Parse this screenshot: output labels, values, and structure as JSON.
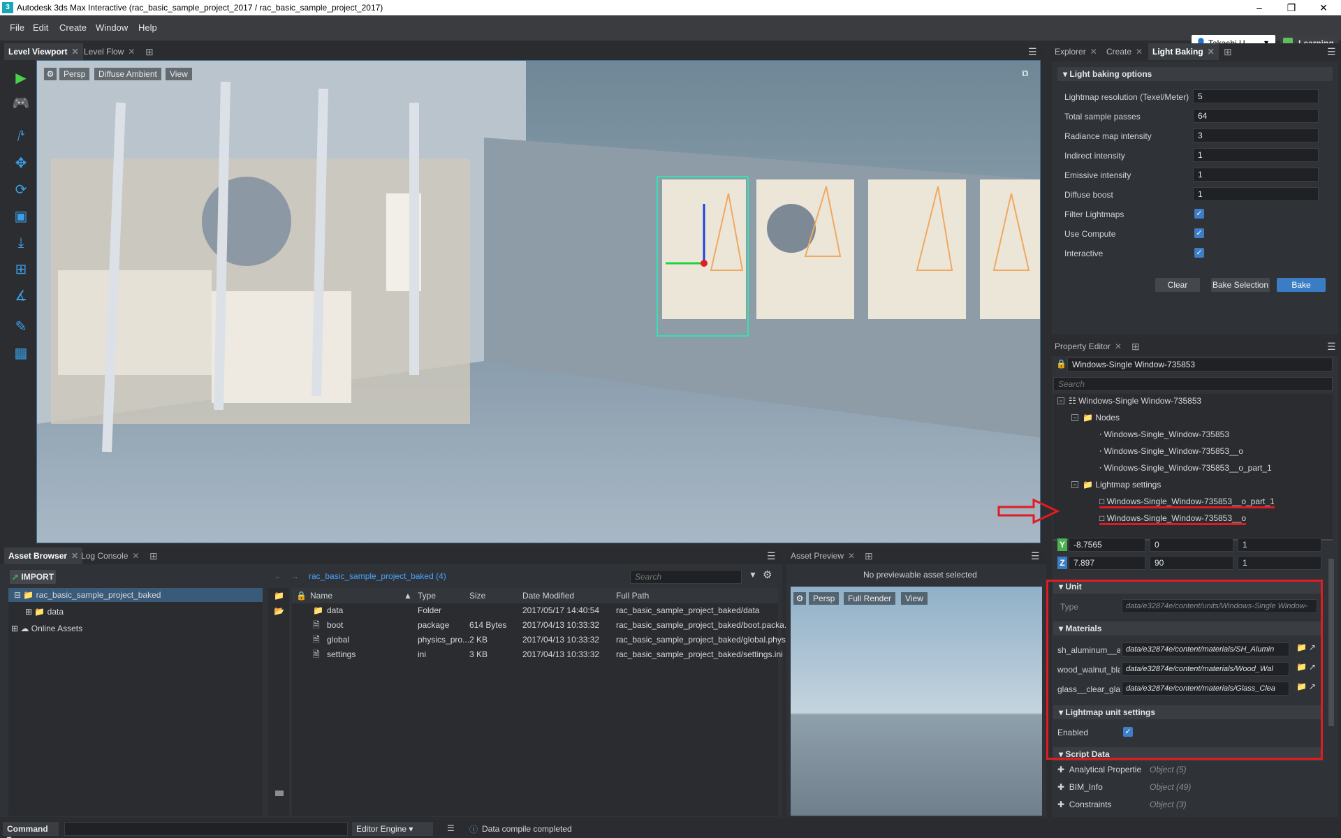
{
  "window": {
    "title": "Autodesk 3ds Max Interactive (rac_basic_sample_project_2017 / rac_basic_sample_project_2017)"
  },
  "menu": [
    "File",
    "Edit",
    "Create",
    "Window",
    "Help"
  ],
  "user": {
    "name": "Takashi U...",
    "learning": "Learning"
  },
  "viewport_tabs": [
    {
      "label": "Level Viewport",
      "active": true
    },
    {
      "label": "Level Flow",
      "active": false
    }
  ],
  "viewport_bar": {
    "persp": "Persp",
    "mode": "Diffuse Ambient",
    "view": "View"
  },
  "right_tabs": [
    {
      "label": "Explorer",
      "active": false
    },
    {
      "label": "Create",
      "active": false
    },
    {
      "label": "Light Baking",
      "active": true
    }
  ],
  "light_baking": {
    "section": "Light baking options",
    "fields": [
      {
        "label": "Lightmap resolution (Texel/Meter)",
        "value": "5"
      },
      {
        "label": "Total sample passes",
        "value": "64"
      },
      {
        "label": "Radiance map intensity",
        "value": "3"
      },
      {
        "label": "Indirect intensity",
        "value": "1"
      },
      {
        "label": "Emissive intensity",
        "value": "1"
      },
      {
        "label": "Diffuse boost",
        "value": "1"
      }
    ],
    "checks": [
      {
        "label": "Filter Lightmaps",
        "checked": true
      },
      {
        "label": "Use Compute",
        "checked": true
      },
      {
        "label": "Interactive",
        "checked": true
      }
    ],
    "buttons": {
      "clear": "Clear",
      "bake_selection": "Bake Selection",
      "bake": "Bake"
    }
  },
  "property_editor": {
    "tab": "Property Editor",
    "object_name": "Windows-Single Window-735853",
    "search_placeholder": "Search",
    "tree": {
      "root": "Windows-Single Window-735853",
      "nodes_label": "Nodes",
      "nodes": [
        "Windows-Single_Window-735853",
        "Windows-Single_Window-735853__o",
        "Windows-Single_Window-735853__o_part_1"
      ],
      "lightmap_label": "Lightmap settings",
      "lightmap": [
        "Windows-Single_Window-735853__o_part_1",
        "Windows-Single_Window-735853__o"
      ]
    },
    "transform": [
      {
        "axis": "Y",
        "v1": "-8.7565",
        "v2": "0",
        "v3": "1"
      },
      {
        "axis": "Z",
        "v1": "7.897",
        "v2": "90",
        "v3": "1"
      }
    ],
    "unit": {
      "label": "Unit",
      "type_label": "Type",
      "type_value": "data/e32874e/content/units/Windows-Single Window-"
    },
    "materials": {
      "label": "Materials",
      "items": [
        {
          "name": "sh_aluminum__anc",
          "path": "data/e32874e/content/materials/SH_Alumin"
        },
        {
          "name": "wood_walnut_blac",
          "path": "data/e32874e/content/materials/Wood_Wal"
        },
        {
          "name": "glass__clear_glazin",
          "path": "data/e32874e/content/materials/Glass_Clea"
        }
      ]
    },
    "lightmap_unit": {
      "label": "Lightmap unit settings",
      "enabled_label": "Enabled",
      "enabled": true
    },
    "script_data": {
      "label": "Script Data",
      "items": [
        {
          "name": "Analytical Propertie",
          "value": "Object (5)"
        },
        {
          "name": "BIM_Info",
          "value": "Object (49)"
        },
        {
          "name": "Constraints",
          "value": "Object (3)"
        }
      ]
    }
  },
  "asset_browser": {
    "tabs": [
      {
        "label": "Asset Browser",
        "active": true
      },
      {
        "label": "Log Console",
        "active": false
      }
    ],
    "import": "IMPORT",
    "breadcrumb": "rac_basic_sample_project_baked (4)",
    "search_placeholder": "Search",
    "tree": [
      {
        "label": "rac_basic_sample_project_baked"
      },
      {
        "label": "data"
      },
      {
        "label": "Online Assets"
      }
    ],
    "columns": [
      "Name",
      "Type",
      "Size",
      "Date Modified",
      "Full Path"
    ],
    "rows": [
      {
        "name": "data",
        "type": "Folder",
        "size": "",
        "date": "2017/05/17 14:40:54",
        "path": "rac_basic_sample_project_baked/data"
      },
      {
        "name": "boot",
        "type": "package",
        "size": "614 Bytes",
        "date": "2017/04/13 10:33:32",
        "path": "rac_basic_sample_project_baked/boot.packa..."
      },
      {
        "name": "global",
        "type": "physics_pro...",
        "size": "2 KB",
        "date": "2017/04/13 10:33:32",
        "path": "rac_basic_sample_project_baked/global.phys..."
      },
      {
        "name": "settings",
        "type": "ini",
        "size": "3 KB",
        "date": "2017/04/13 10:33:32",
        "path": "rac_basic_sample_project_baked/settings.ini"
      }
    ]
  },
  "asset_preview": {
    "tab": "Asset Preview",
    "message": "No previewable asset selected",
    "bar": {
      "persp": "Persp",
      "render": "Full Render",
      "view": "View"
    }
  },
  "statusbar": {
    "command": "Command",
    "engine": "Editor Engine",
    "status": "Data compile completed"
  },
  "colors": {
    "accent": "#3a7dc4",
    "annotation": "#e01b22"
  }
}
